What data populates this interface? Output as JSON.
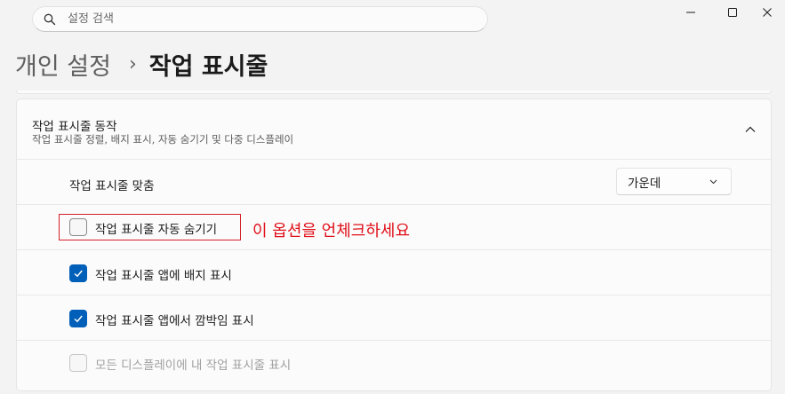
{
  "search": {
    "placeholder": "설정 검색"
  },
  "window": {
    "minimize_icon": "minimize-icon",
    "maximize_icon": "maximize-icon",
    "close_icon": "close-icon"
  },
  "breadcrumb": {
    "parent": "개인 설정",
    "separator": "›",
    "current": "작업 표시줄"
  },
  "section": {
    "title": "작업 표시줄 동작",
    "description": "작업 표시줄 정렬, 배지 표시, 자동 숨기기 및 다중 디스플레이",
    "expanded": true
  },
  "alignment": {
    "label": "작업 표시줄 맞춤",
    "value": "가운데"
  },
  "options": [
    {
      "label": "작업 표시줄 자동 숨기기",
      "checked": false,
      "disabled": false
    },
    {
      "label": "작업 표시줄 앱에 배지 표시",
      "checked": true,
      "disabled": false
    },
    {
      "label": "작업 표시줄 앱에서 깜박임 표시",
      "checked": true,
      "disabled": false
    },
    {
      "label": "모든 디스플레이에 내 작업 표시줄 표시",
      "checked": false,
      "disabled": true
    }
  ],
  "annotation": {
    "text": "이 옵션을 언체크하세요",
    "color": "#e0101a"
  },
  "colors": {
    "accent": "#005fb8",
    "highlight_border": "#d3202a"
  }
}
